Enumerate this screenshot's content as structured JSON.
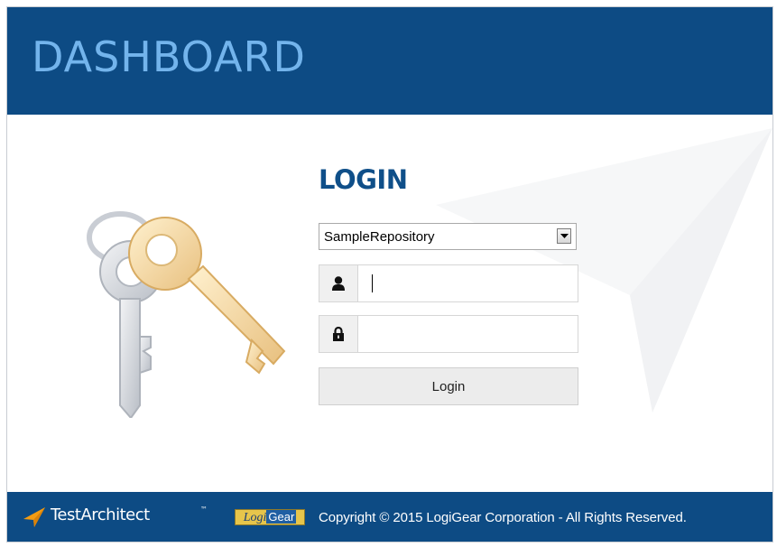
{
  "header": {
    "title": "DASHBOARD"
  },
  "login": {
    "title": "LOGIN",
    "repository": {
      "selected": "SampleRepository"
    },
    "username": {
      "value": "",
      "placeholder": ""
    },
    "password": {
      "value": "",
      "placeholder": ""
    },
    "submit_label": "Login"
  },
  "icons": {
    "keys": "keys-illustration",
    "user": "user-icon",
    "lock": "lock-icon",
    "dropdown": "chevron-down-icon",
    "testarchitect": "testarchitect-logo"
  },
  "footer": {
    "product": "TestArchitect",
    "product_tm": "™",
    "logigear_part1": "Logi",
    "logigear_part2": "Gear",
    "copyright": "Copyright © 2015 LogiGear Corporation - All Rights Reserved."
  },
  "colors": {
    "header_bg": "#0d4b84",
    "header_title": "#73b4ec",
    "login_title": "#0f4f89",
    "footer_bg": "#0d4b84",
    "accent_orange": "#f39c12"
  }
}
